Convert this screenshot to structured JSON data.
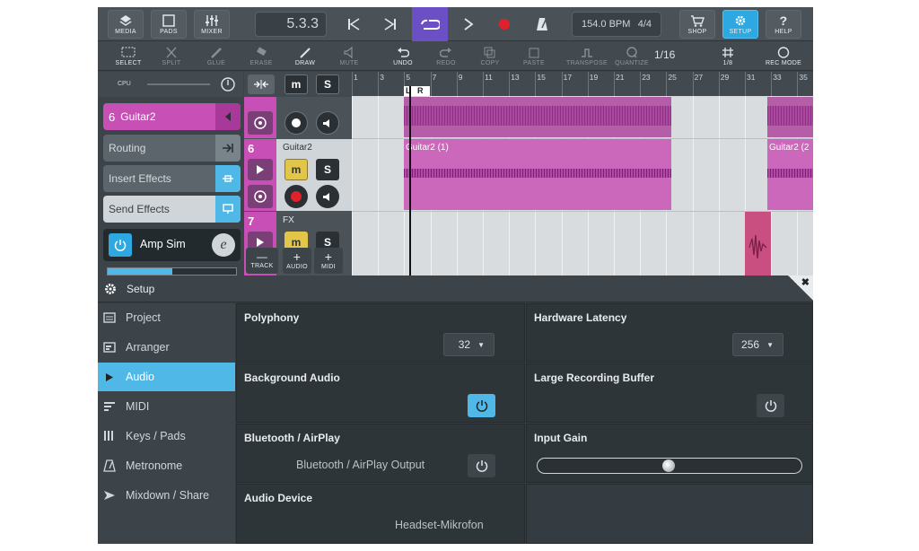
{
  "toolbar": {
    "media": "MEDIA",
    "pads": "PADS",
    "mixer": "MIXER",
    "position": "5.3.3",
    "bpm": "154.0 BPM",
    "signature": "4/4",
    "shop": "SHOP",
    "setup": "SETUP",
    "help": "HELP"
  },
  "edit_toolbar": {
    "select": "SELECT",
    "split": "SPLIT",
    "glue": "GLUE",
    "erase": "ERASE",
    "draw": "DRAW",
    "mute": "MUTE",
    "undo": "UNDO",
    "redo": "REDO",
    "copy": "COPY",
    "paste": "PASTE",
    "transpose": "TRANSPOSE",
    "quantize": "QUANTIZE",
    "quantize_value": "1/16",
    "grid": "1/8",
    "rec_mode": "REC MODE"
  },
  "inspector": {
    "cpu": "CPU",
    "track_number": "6",
    "track_name": "Guitar2",
    "routing": "Routing",
    "insert_effects": "Insert Effects",
    "send_effects": "Send Effects",
    "plugin": "Amp Sim",
    "plugin_edit": "e"
  },
  "tracks": {
    "m": "m",
    "s": "S",
    "track6_number": "6",
    "track6_name": "Guitar2",
    "track7_number": "7",
    "track7_name": "FX",
    "add_track": "TRACK",
    "add_audio": "AUDIO",
    "add_midi": "MIDI"
  },
  "ruler": {
    "bars": [
      "1",
      "3",
      "5",
      "7",
      "9",
      "11",
      "13",
      "15",
      "17",
      "19",
      "21",
      "23",
      "25",
      "27",
      "29",
      "31",
      "33",
      "35"
    ],
    "loop_l": "L",
    "loop_r": "R"
  },
  "clips": {
    "clip1": "Guitar2 (1)",
    "clip2": "Guitar2 (2"
  },
  "setup": {
    "title": "Setup",
    "nav": [
      "Project",
      "Arranger",
      "Audio",
      "MIDI",
      "Keys / Pads",
      "Metronome",
      "Mixdown / Share"
    ],
    "active": "Audio",
    "polyphony": {
      "label": "Polyphony",
      "value": "32"
    },
    "latency": {
      "label": "Hardware Latency",
      "value": "256"
    },
    "background_audio": {
      "label": "Background Audio",
      "enabled": true
    },
    "large_buffer": {
      "label": "Large Recording Buffer",
      "enabled": false
    },
    "bluetooth": {
      "label": "Bluetooth / AirPlay",
      "value": "Bluetooth / AirPlay Output",
      "enabled": false
    },
    "input_gain": {
      "label": "Input Gain",
      "level": 0.5
    },
    "audio_device": {
      "label": "Audio Device",
      "value": "Headset-Mikrofon"
    }
  },
  "colors": {
    "accent": "#2ea8e0",
    "clip": "#c84fb5",
    "loop": "#6a4fc5",
    "record": "#e0202a"
  }
}
